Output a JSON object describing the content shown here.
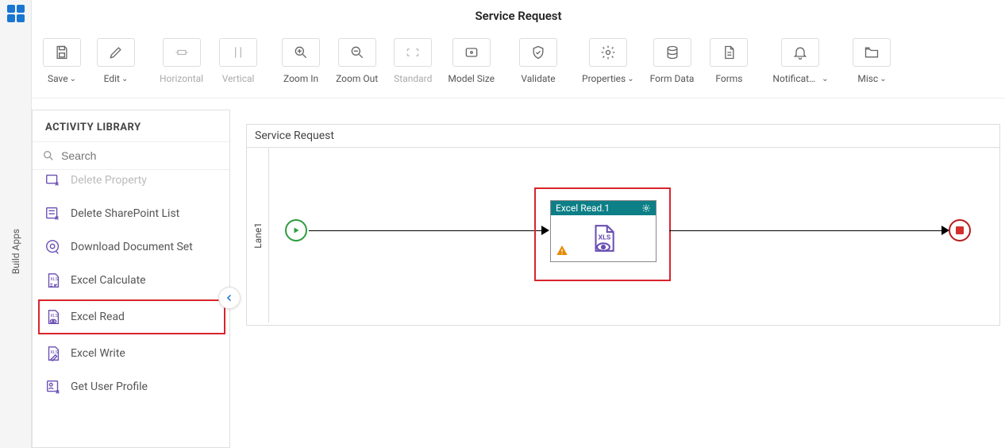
{
  "rail": {
    "vertical_label": "Build Apps"
  },
  "header": {
    "title": "Service Request"
  },
  "toolbar": {
    "save": "Save",
    "edit": "Edit",
    "horizontal": "Horizontal",
    "vertical": "Vertical",
    "zoom_in": "Zoom In",
    "zoom_out": "Zoom Out",
    "standard": "Standard",
    "model_size": "Model Size",
    "validate": "Validate",
    "properties": "Properties",
    "form_data": "Form Data",
    "forms": "Forms",
    "notifications": "Notificat…",
    "misc": "Misc"
  },
  "sidebar": {
    "title": "ACTIVITY LIBRARY",
    "search_placeholder": "Search",
    "items": [
      {
        "label": "Delete Property"
      },
      {
        "label": "Delete SharePoint List"
      },
      {
        "label": "Download Document Set"
      },
      {
        "label": "Excel Calculate"
      },
      {
        "label": "Excel Read"
      },
      {
        "label": "Excel Write"
      },
      {
        "label": "Get User Profile"
      }
    ]
  },
  "canvas": {
    "title": "Service Request",
    "lane": "Lane1",
    "activity": {
      "title": "Excel Read.1"
    }
  }
}
